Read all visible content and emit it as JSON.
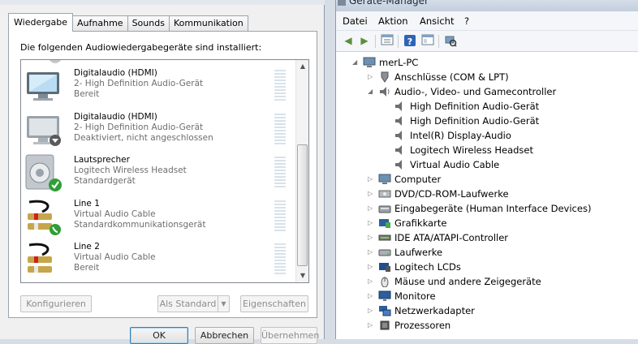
{
  "sound": {
    "tabs": [
      "Wiedergabe",
      "Aufnahme",
      "Sounds",
      "Kommunikation"
    ],
    "active_tab": "Wiedergabe",
    "panel_label": "Die folgenden Audiowiedergabegeräte sind installiert:",
    "devices": [
      {
        "name": "Digitalaudio (HDMI)",
        "desc": "2- High Definition Audio-Gerät",
        "status": "Bereit",
        "icon": "monitor-icon"
      },
      {
        "name": "Digitalaudio (HDMI)",
        "desc": "2- High Definition Audio-Gerät",
        "status": "Deaktiviert, nicht angeschlossen",
        "icon": "monitor-disconnected-icon"
      },
      {
        "name": "Lautsprecher",
        "desc": "Logitech Wireless Headset",
        "status": "Standardgerät",
        "icon": "speaker-default-icon"
      },
      {
        "name": "Line 1",
        "desc": "Virtual Audio Cable",
        "status": "Standardkommunikationsgerät",
        "icon": "cable-comm-icon"
      },
      {
        "name": "Line 2",
        "desc": "Virtual Audio Cable",
        "status": "Bereit",
        "icon": "cable-icon"
      }
    ],
    "buttons": {
      "configure": "Konfigurieren",
      "set_default": "Als Standard",
      "properties": "Eigenschaften",
      "ok": "OK",
      "cancel": "Abbrechen",
      "apply": "Übernehmen"
    }
  },
  "devmgr": {
    "title": "Geräte-Manager",
    "menu": [
      "Datei",
      "Aktion",
      "Ansicht",
      "?"
    ],
    "tree": [
      {
        "label": "merL-PC",
        "level": 0,
        "expanded": true,
        "icon": "computer-icon"
      },
      {
        "label": "Anschlüsse (COM & LPT)",
        "level": 1,
        "expanded": false,
        "icon": "port-icon"
      },
      {
        "label": "Audio-, Video- und Gamecontroller",
        "level": 1,
        "expanded": true,
        "icon": "audio-icon"
      },
      {
        "label": "High Definition Audio-Gerät",
        "level": 2,
        "icon": "audio-device-icon"
      },
      {
        "label": "High Definition Audio-Gerät",
        "level": 2,
        "icon": "audio-device-icon"
      },
      {
        "label": "Intel(R) Display-Audio",
        "level": 2,
        "icon": "audio-device-icon"
      },
      {
        "label": "Logitech Wireless Headset",
        "level": 2,
        "icon": "audio-device-icon"
      },
      {
        "label": "Virtual Audio Cable",
        "level": 2,
        "icon": "audio-device-icon"
      },
      {
        "label": "Computer",
        "level": 1,
        "expanded": false,
        "icon": "computer-icon"
      },
      {
        "label": "DVD/CD-ROM-Laufwerke",
        "level": 1,
        "expanded": false,
        "icon": "dvd-icon"
      },
      {
        "label": "Eingabegeräte (Human Interface Devices)",
        "level": 1,
        "expanded": false,
        "icon": "hid-icon"
      },
      {
        "label": "Grafikkarte",
        "level": 1,
        "expanded": false,
        "icon": "display-adapter-icon"
      },
      {
        "label": "IDE ATA/ATAPI-Controller",
        "level": 1,
        "expanded": false,
        "icon": "ide-icon"
      },
      {
        "label": "Laufwerke",
        "level": 1,
        "expanded": false,
        "icon": "drive-icon"
      },
      {
        "label": "Logitech LCDs",
        "level": 1,
        "expanded": false,
        "icon": "lcd-icon"
      },
      {
        "label": "Mäuse und andere Zeigegeräte",
        "level": 1,
        "expanded": false,
        "icon": "mouse-icon"
      },
      {
        "label": "Monitore",
        "level": 1,
        "expanded": false,
        "icon": "monitor-icon"
      },
      {
        "label": "Netzwerkadapter",
        "level": 1,
        "expanded": false,
        "icon": "network-icon"
      },
      {
        "label": "Prozessoren",
        "level": 1,
        "expanded": false,
        "icon": "processor-icon"
      }
    ]
  }
}
